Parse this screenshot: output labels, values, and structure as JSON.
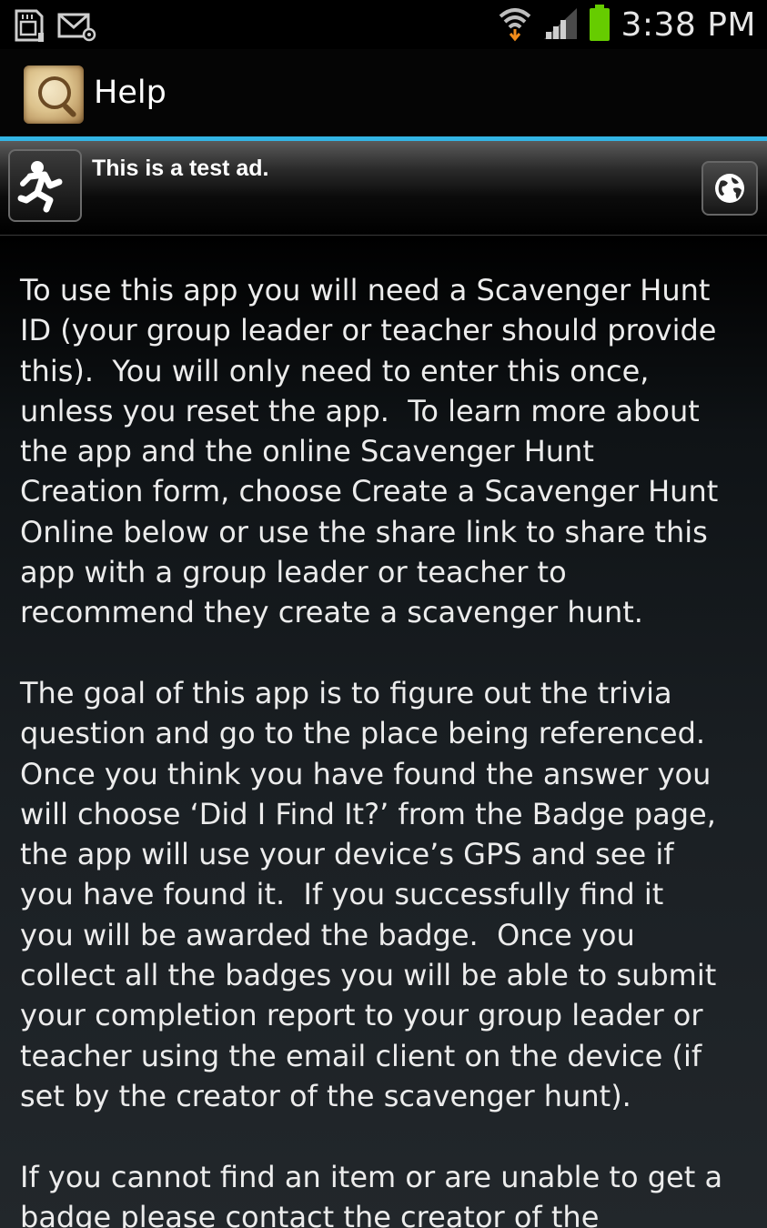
{
  "status_bar": {
    "time": "3:38 PM",
    "icons": [
      "sd-card-icon",
      "email-icon",
      "wifi-icon",
      "signal-icon",
      "battery-icon"
    ],
    "battery_color": "#66cc00"
  },
  "action_bar": {
    "title": "Help",
    "icon": "magnifier-map-icon"
  },
  "ad": {
    "text": "This is a test ad.",
    "logo_icon": "running-man-icon",
    "button_icon": "globe-icon"
  },
  "help": {
    "text": "To use this app you will need a Scavenger Hunt\nID (your group leader or teacher should provide\nthis).  You will only need to enter this once,\nunless you reset the app.  To learn more about\nthe app and the online Scavenger Hunt\nCreation form, choose Create a Scavenger Hunt\nOnline below or use the share link to share this\napp with a group leader or teacher to\nrecommend they create a scavenger hunt.\n\nThe goal of this app is to figure out the trivia\nquestion and go to the place being referenced.\nOnce you think you have found the answer you\nwill choose ‘Did I Find It?’ from the Badge page,\nthe app will use your device’s GPS and see if\nyou have found it.  If you successfully find it\nyou will be awarded the badge.  Once you\ncollect all the badges you will be able to submit\nyour completion report to your group leader or\nteacher using the email client on the device (if\nset by the creator of the scavenger hunt).\n\nIf you cannot find an item or are unable to get a\nbadge please contact the creator of the"
  },
  "colors": {
    "accent": "#33b5e5",
    "text": "#ececec",
    "background": "#000000"
  }
}
